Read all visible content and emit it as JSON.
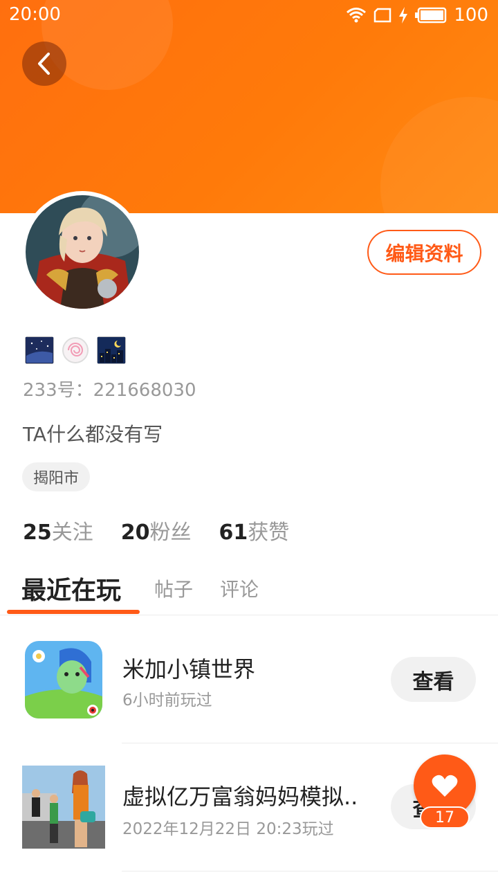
{
  "status_bar": {
    "time": "20:00",
    "battery": "100"
  },
  "profile": {
    "user_id": "233号：221668030",
    "bio": "TA什么都没有写",
    "location": "揭阳市",
    "edit_label": "编辑资料"
  },
  "stats": [
    {
      "num": "25",
      "label": "关注"
    },
    {
      "num": "20",
      "label": "粉丝"
    },
    {
      "num": "61",
      "label": "获赞"
    }
  ],
  "tabs": [
    "最近在玩",
    "帖子",
    "评论"
  ],
  "games": [
    {
      "title": "米加小镇世界",
      "time": "6小时前玩过",
      "button": "查看"
    },
    {
      "title": "虚拟亿万富翁妈妈模拟..",
      "time": "2022年12月22日 20:23玩过",
      "button": "查看"
    }
  ],
  "fab": {
    "count": "17"
  },
  "colors": {
    "accent": "#ff5a17",
    "header": "#ff7a0a"
  }
}
